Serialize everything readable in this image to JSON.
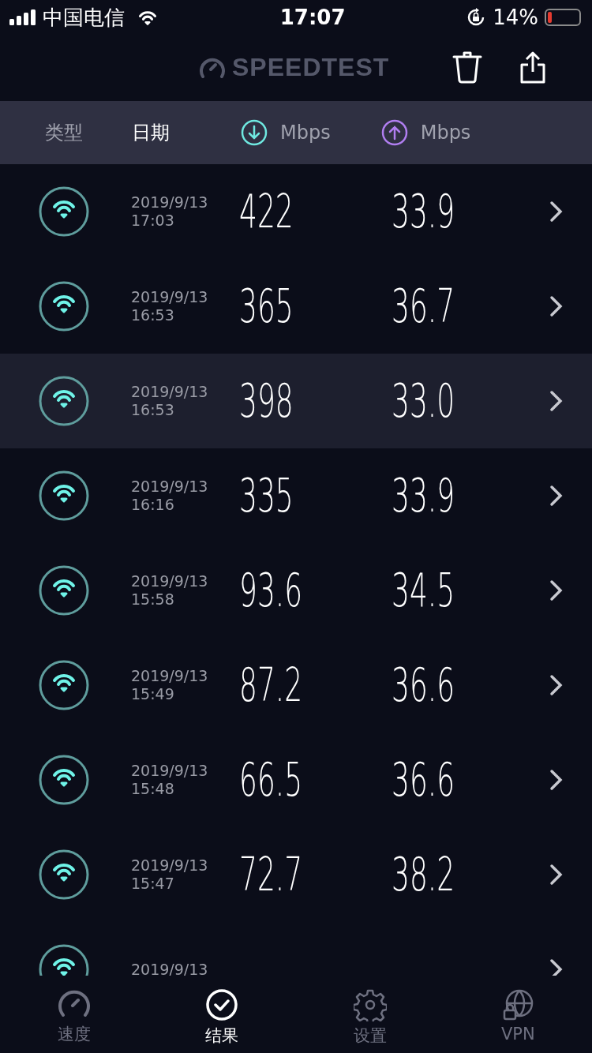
{
  "status_bar": {
    "carrier": "中国电信",
    "time": "17:07",
    "battery": "14%"
  },
  "header": {
    "logo": "SPEEDTEST"
  },
  "columns": [
    {
      "label": "类型",
      "kind": "text",
      "selected": false
    },
    {
      "label": "日期",
      "kind": "text",
      "selected": true
    },
    {
      "label": "Mbps",
      "kind": "download",
      "selected": false
    },
    {
      "label": "Mbps",
      "kind": "upload",
      "selected": false
    }
  ],
  "results": [
    {
      "date": "2019/9/13",
      "time": "17:03",
      "download": "422",
      "upload": "33.9",
      "selected": false
    },
    {
      "date": "2019/9/13",
      "time": "16:53",
      "download": "365",
      "upload": "36.7",
      "selected": false
    },
    {
      "date": "2019/9/13",
      "time": "16:53",
      "download": "398",
      "upload": "33.0",
      "selected": true
    },
    {
      "date": "2019/9/13",
      "time": "16:16",
      "download": "335",
      "upload": "33.9",
      "selected": false
    },
    {
      "date": "2019/9/13",
      "time": "15:58",
      "download": "93.6",
      "upload": "34.5",
      "selected": false
    },
    {
      "date": "2019/9/13",
      "time": "15:49",
      "download": "87.2",
      "upload": "36.6",
      "selected": false
    },
    {
      "date": "2019/9/13",
      "time": "15:48",
      "download": "66.5",
      "upload": "36.6",
      "selected": false
    },
    {
      "date": "2019/9/13",
      "time": "15:47",
      "download": "72.7",
      "upload": "38.2",
      "selected": false
    },
    {
      "date": "2019/9/13",
      "selected": false
    }
  ],
  "tab_bar": [
    {
      "label": "速度",
      "kind": "speed",
      "selected": false
    },
    {
      "label": "结果",
      "kind": "results",
      "selected": true
    },
    {
      "label": "设置",
      "kind": "settings",
      "selected": false
    },
    {
      "label": "VPN",
      "kind": "vpn",
      "selected": false
    }
  ]
}
